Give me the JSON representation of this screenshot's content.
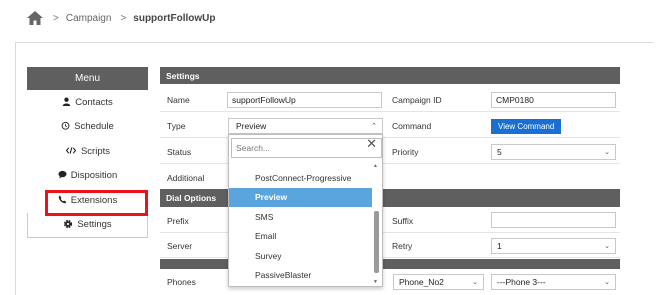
{
  "breadcrumb": {
    "home_icon": "home-icon",
    "sep1": ">",
    "campaign": "Campaign",
    "sep2": ">",
    "current": "supportFollowUp"
  },
  "menu": {
    "header": "Menu",
    "items": [
      {
        "label": "Contacts",
        "icon": "user-icon",
        "glyph": "👤"
      },
      {
        "label": "Schedule",
        "icon": "clock-icon",
        "glyph": "⏰"
      },
      {
        "label": "Scripts",
        "icon": "code-icon",
        "glyph": "</>"
      },
      {
        "label": "Disposition",
        "icon": "comment-icon",
        "glyph": "💬"
      },
      {
        "label": "Extensions",
        "icon": "phone-icon",
        "glyph": "📞"
      },
      {
        "label": "Settings",
        "icon": "gear-icon",
        "glyph": "⚙"
      }
    ],
    "highlight_color": "#e8141b"
  },
  "settings": {
    "header": "Settings",
    "name_label": "Name",
    "name_value": "supportFollowUp",
    "campaign_id_label": "Campaign ID",
    "campaign_id_value": "CMP0180",
    "type_label": "Type",
    "type_value": "Preview",
    "command_label": "Command",
    "view_command": "View Command",
    "status_label": "Status",
    "priority_label": "Priority",
    "priority_value": "5",
    "additional_label": "Additional"
  },
  "dial_options": {
    "header": "Dial Options",
    "prefix_label": "Prefix",
    "suffix_label": "Suffix",
    "server_label": "Server",
    "retry_label": "Retry",
    "retry_value": "1",
    "phones_label": "Phones",
    "phone2_value": "Phone_No2",
    "phone3_value": "---Phone 3---"
  },
  "dropdown": {
    "search_placeholder": "Search...",
    "clear": "✕",
    "options": [
      "PostConnect-Progressive",
      "Preview",
      "SMS",
      "Email",
      "Survey",
      "PassiveBlaster"
    ],
    "selected_index": 1
  },
  "colors": {
    "header_bg": "#5f5f5f",
    "button": "#1a6fd1",
    "selected": "#5aa5dd"
  }
}
